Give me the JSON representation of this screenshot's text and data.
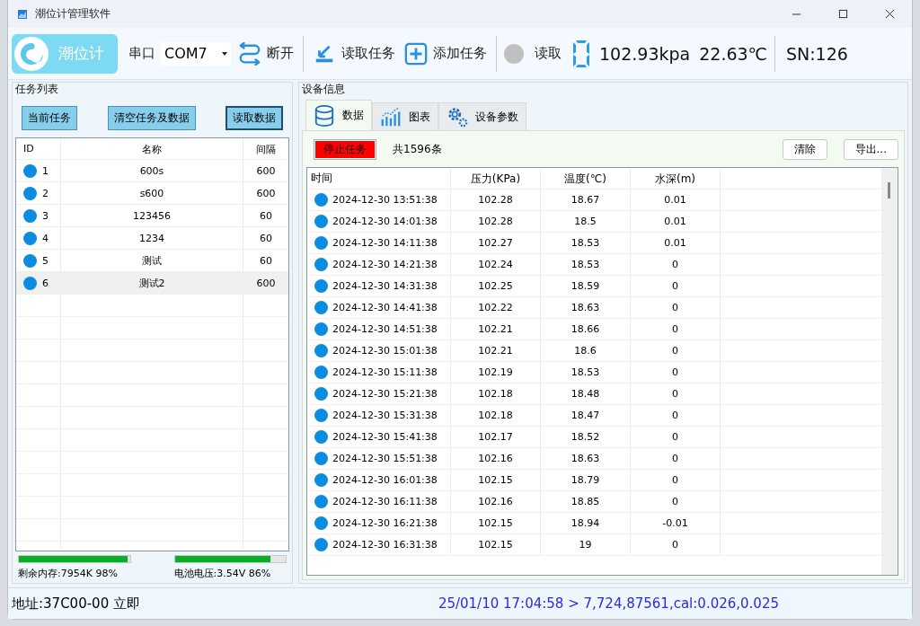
{
  "window": {
    "title": "潮位计管理软件"
  },
  "toolbar": {
    "logo_text": "潮位计",
    "port_label": "串口",
    "port_value": "COM7",
    "disconnect": "断开",
    "read_tasks": "读取任务",
    "add_task": "添加任务",
    "read_label": "读取",
    "pressure": "102.93kpa",
    "temperature": "22.63℃",
    "serial": "SN:126"
  },
  "task_panel": {
    "title": "任务列表",
    "buttons": [
      {
        "label": "当前任务",
        "selected": false
      },
      {
        "label": "清空任务及数据",
        "selected": false
      },
      {
        "label": "读取数据",
        "selected": true
      }
    ],
    "columns": [
      "ID",
      "名称",
      "间隔"
    ],
    "rows": [
      {
        "id": "1",
        "name": "600s",
        "interval": "600",
        "selected": false
      },
      {
        "id": "2",
        "name": "s600",
        "interval": "600",
        "selected": false
      },
      {
        "id": "3",
        "name": "123456",
        "interval": "60",
        "selected": false
      },
      {
        "id": "4",
        "name": "1234",
        "interval": "60",
        "selected": false
      },
      {
        "id": "5",
        "name": "测试",
        "interval": "60",
        "selected": false
      },
      {
        "id": "6",
        "name": "测试2",
        "interval": "600",
        "selected": true
      }
    ],
    "memory": {
      "level": 0.98,
      "text": "剩余内存:7954K 98%"
    },
    "battery": {
      "level": 0.86,
      "text": "电池电压:3.54V 86%"
    }
  },
  "device_panel": {
    "title": "设备信息",
    "tabs": [
      {
        "label": "数据",
        "selected": true
      },
      {
        "label": "图表",
        "selected": false
      },
      {
        "label": "设备参数",
        "selected": false
      }
    ],
    "stop_button": "停止任务",
    "count": "共1596条",
    "clear_button": "清除",
    "export_button": "导出...",
    "columns": [
      "时间",
      "压力(KPa)",
      "温度(℃)",
      "水深(m)"
    ],
    "rows": [
      [
        "2024-12-30 13:51:38",
        "102.28",
        "18.67",
        "0.01"
      ],
      [
        "2024-12-30 14:01:38",
        "102.28",
        "18.5",
        "0.01"
      ],
      [
        "2024-12-30 14:11:38",
        "102.27",
        "18.53",
        "0.01"
      ],
      [
        "2024-12-30 14:21:38",
        "102.24",
        "18.53",
        "0"
      ],
      [
        "2024-12-30 14:31:38",
        "102.25",
        "18.59",
        "0"
      ],
      [
        "2024-12-30 14:41:38",
        "102.22",
        "18.63",
        "0"
      ],
      [
        "2024-12-30 14:51:38",
        "102.21",
        "18.66",
        "0"
      ],
      [
        "2024-12-30 15:01:38",
        "102.21",
        "18.6",
        "0"
      ],
      [
        "2024-12-30 15:11:38",
        "102.19",
        "18.53",
        "0"
      ],
      [
        "2024-12-30 15:21:38",
        "102.18",
        "18.48",
        "0"
      ],
      [
        "2024-12-30 15:31:38",
        "102.18",
        "18.47",
        "0"
      ],
      [
        "2024-12-30 15:41:38",
        "102.17",
        "18.52",
        "0"
      ],
      [
        "2024-12-30 15:51:38",
        "102.16",
        "18.63",
        "0"
      ],
      [
        "2024-12-30 16:01:38",
        "102.15",
        "18.79",
        "0"
      ],
      [
        "2024-12-30 16:11:38",
        "102.16",
        "18.85",
        "0"
      ],
      [
        "2024-12-30 16:21:38",
        "102.15",
        "18.94",
        "-0.01"
      ],
      [
        "2024-12-30 16:31:38",
        "102.15",
        "19",
        "0"
      ]
    ]
  },
  "status_bar": {
    "address": "地址:37C00-00 立即",
    "message": "25/01/10 17:04:58 > 7,724,87561,cal:0.026,0.025"
  }
}
